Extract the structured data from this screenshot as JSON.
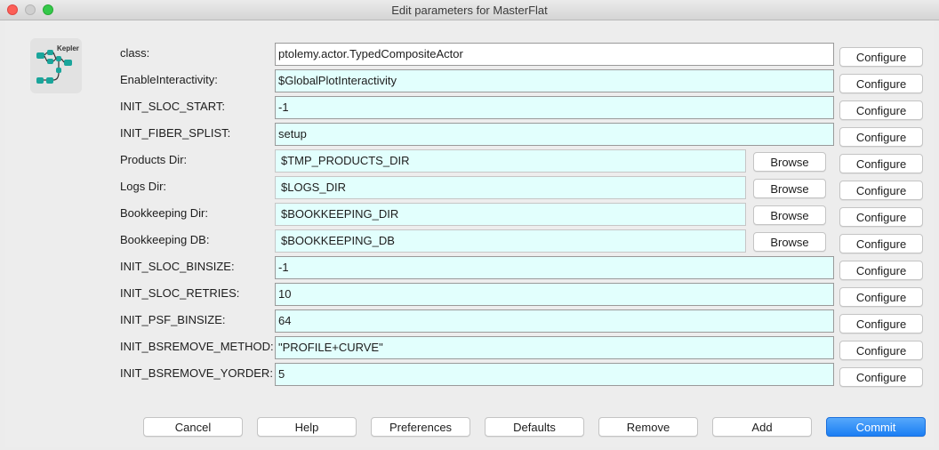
{
  "window": {
    "title": "Edit parameters for MasterFlat"
  },
  "logo": {
    "text": "Kepler"
  },
  "params": [
    {
      "label": "class:",
      "value": "ptolemy.actor.TypedCompositeActor",
      "style": "white",
      "browse": null,
      "configure": "Configure"
    },
    {
      "label": "EnableInteractivity:",
      "value": "$GlobalPlotInteractivity",
      "style": "wide",
      "browse": null,
      "configure": "Configure"
    },
    {
      "label": "INIT_SLOC_START:",
      "value": "-1",
      "style": "wide",
      "browse": null,
      "configure": "Configure"
    },
    {
      "label": "INIT_FIBER_SPLIST:",
      "value": "setup",
      "style": "wide",
      "browse": null,
      "configure": "Configure"
    },
    {
      "label": "Products Dir:",
      "value": "$TMP_PRODUCTS_DIR",
      "style": "short",
      "browse": "Browse",
      "configure": "Configure"
    },
    {
      "label": "Logs Dir:",
      "value": "$LOGS_DIR",
      "style": "short",
      "browse": "Browse",
      "configure": "Configure"
    },
    {
      "label": "Bookkeeping Dir:",
      "value": "$BOOKKEEPING_DIR",
      "style": "short",
      "browse": "Browse",
      "configure": "Configure"
    },
    {
      "label": "Bookkeeping DB:",
      "value": "$BOOKKEEPING_DB",
      "style": "short",
      "browse": "Browse",
      "configure": "Configure"
    },
    {
      "label": "INIT_SLOC_BINSIZE:",
      "value": "-1",
      "style": "wide",
      "browse": null,
      "configure": "Configure"
    },
    {
      "label": "INIT_SLOC_RETRIES:",
      "value": "10",
      "style": "wide",
      "browse": null,
      "configure": "Configure"
    },
    {
      "label": "INIT_PSF_BINSIZE:",
      "value": "64",
      "style": "wide",
      "browse": null,
      "configure": "Configure"
    },
    {
      "label": "INIT_BSREMOVE_METHOD:",
      "value": "\"PROFILE+CURVE\"",
      "style": "wide",
      "browse": null,
      "configure": "Configure"
    },
    {
      "label": "INIT_BSREMOVE_YORDER:",
      "value": "5",
      "style": "wide",
      "browse": null,
      "configure": "Configure"
    }
  ],
  "footer": {
    "cancel": "Cancel",
    "help": "Help",
    "preferences": "Preferences",
    "defaults": "Defaults",
    "remove": "Remove",
    "add": "Add",
    "commit": "Commit"
  }
}
